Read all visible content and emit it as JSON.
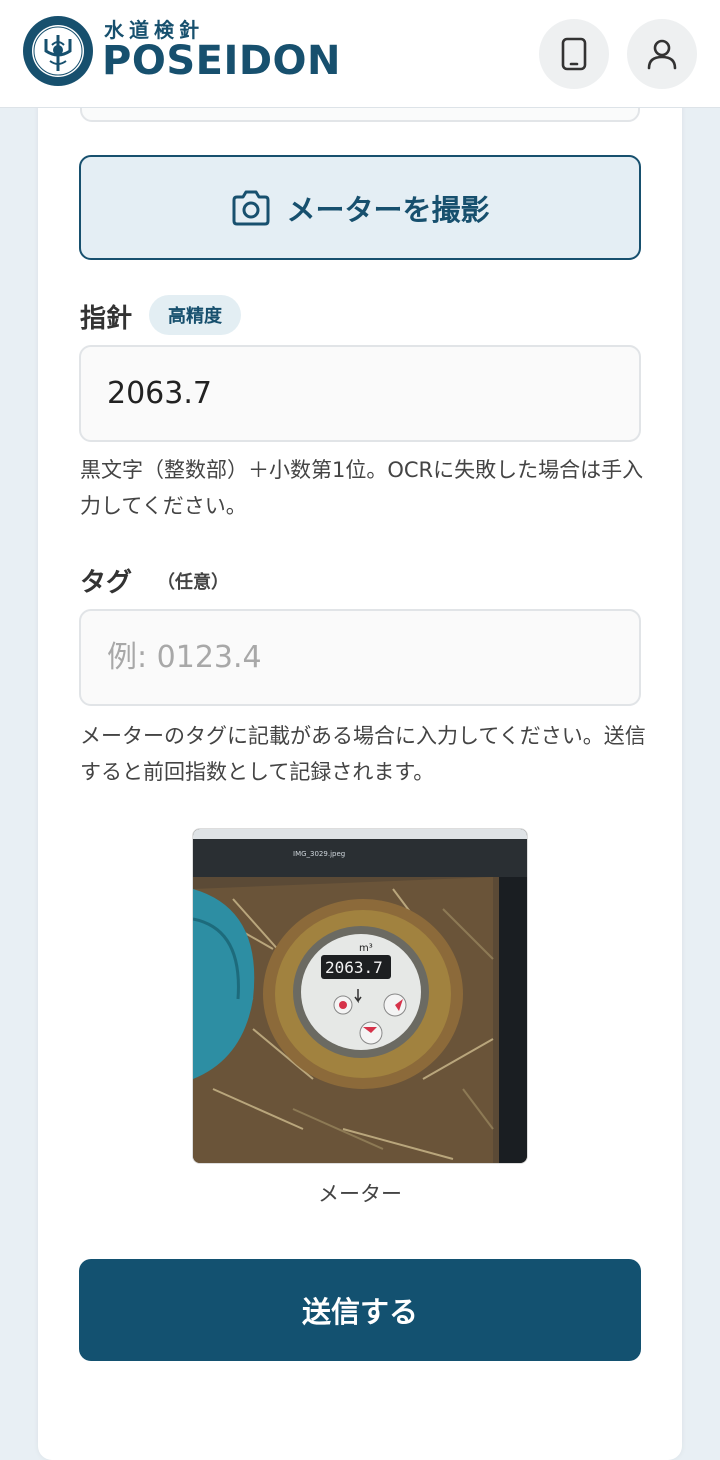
{
  "header": {
    "logo_sub": "水道検針",
    "logo_main": "POSEIDON",
    "emblem_top": "POSEIDON",
    "emblem_bottom": "WATER METERING",
    "emblem_small": "READING SYSTEM"
  },
  "capture": {
    "label": "メーターを撮影"
  },
  "reading": {
    "label": "指針",
    "badge": "高精度",
    "value": "2063.7",
    "help": "黒文字（整数部）＋小数第1位。OCRに失敗した場合は手入力してください。"
  },
  "tag": {
    "label": "タグ",
    "optional": "（任意）",
    "placeholder": "例: 0123.4",
    "help": "メーターのタグに記載がある場合に入力してください。送信すると前回指数として記録されます。"
  },
  "photo": {
    "caption": "メーター",
    "window_title": "IMG_3029.jpeg",
    "meter_reading": "2063.7",
    "meter_unit": "m³"
  },
  "submit": {
    "label": "送信する"
  },
  "colors": {
    "brand": "#17506e",
    "submit_bg": "#135170",
    "page_bg": "#e8eff4"
  }
}
